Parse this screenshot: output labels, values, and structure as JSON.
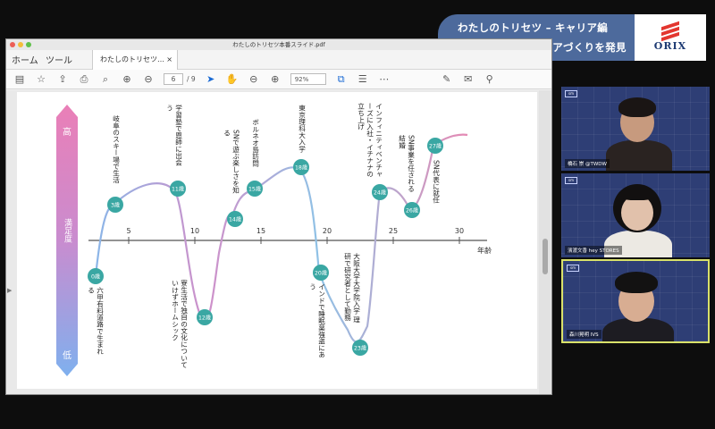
{
  "banner": {
    "line1": "わたしのトリセツ – キャリア編",
    "line2": "新しい時代のキャリアづくりを発見",
    "logo_text": "ORIX"
  },
  "window": {
    "title": "わたしのトリセツ本番スライド.pdf",
    "menu_home": "ホーム",
    "menu_tools": "ツール",
    "doc_tab": "わたしのトリセツ…",
    "doc_tab_close": "×",
    "page_current": "6",
    "page_total": "/ 9",
    "zoom": "92%"
  },
  "slide": {
    "scale_high": "高",
    "scale_mid": "満足度",
    "scale_low": "低",
    "axis_label": "年齢",
    "ticks": [
      "5",
      "10",
      "15",
      "20",
      "25",
      "30"
    ],
    "events": [
      {
        "age": "0歳",
        "text": "六甲有料道路で生まれる"
      },
      {
        "age": "3歳",
        "text": "岐阜のスキー場で生活"
      },
      {
        "age": "11歳",
        "text": "学習塾で恩師に出会う"
      },
      {
        "age": "12歳",
        "text": "寮生活で独自の文化についていけずホームシック"
      },
      {
        "age": "14歳",
        "text": "SNで遊ぶ楽しさを知る"
      },
      {
        "age": "15歳",
        "text": "ボルネオ島訪問"
      },
      {
        "age": "18歳",
        "text": "東京理科大入学"
      },
      {
        "age": "20歳",
        "text": "インドで睡眠薬強盗にあう"
      },
      {
        "age": "23歳",
        "text": "大阪大学大学院入学 理研で研究者として勤務"
      },
      {
        "age": "24歳",
        "text": "インフィニティベンチャーズに入社・イチナナの立ち上げ"
      },
      {
        "age": "26歳",
        "text": "SN事業を任される 結婚"
      },
      {
        "age": "27歳",
        "text": "SN代表に就任"
      }
    ]
  },
  "participants": [
    {
      "name": "橋石 崇 @TWDW",
      "badge": "sm"
    },
    {
      "name": "濱渡文香 hey STORES",
      "badge": "sm"
    },
    {
      "name": "森川晃明 IVS",
      "badge": "sm"
    }
  ]
}
